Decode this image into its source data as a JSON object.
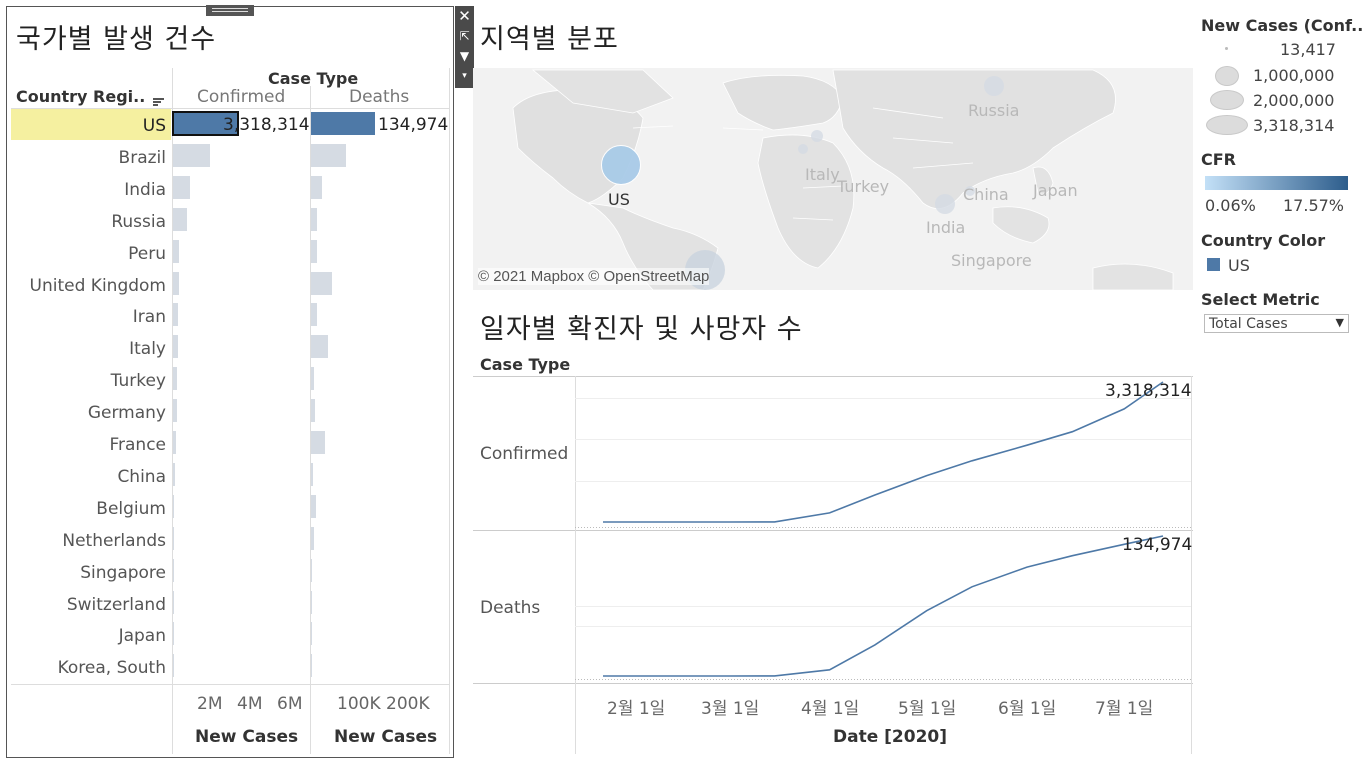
{
  "sheets": {
    "country_title": "국가별 발생 건수",
    "map_title": "지역별 분포",
    "daily_title": "일자별 확진자 및 사망자 수"
  },
  "bar_table": {
    "row_header": "Country Regi..",
    "case_type_header": "Case Type",
    "columns": [
      "Confirmed",
      "Deaths"
    ],
    "axis_title": "New Cases",
    "confirmed_ticks": [
      "2M",
      "4M",
      "6M"
    ],
    "deaths_ticks": [
      "100K",
      "200K"
    ],
    "us_confirmed_label": "3,318,314",
    "us_deaths_label": "134,974"
  },
  "map": {
    "attribution": "© 2021 Mapbox © OpenStreetMap",
    "labels": [
      "US",
      "Russia",
      "Italy",
      "Turkey",
      "China",
      "Japan",
      "India",
      "Singapore"
    ]
  },
  "line_panel": {
    "case_type_header": "Case Type",
    "row_confirmed": "Confirmed",
    "row_deaths": "Deaths",
    "x_title": "Date [2020]",
    "confirmed_end_label": "3,318,314",
    "deaths_end_label": "134,974"
  },
  "legend": {
    "size_title": "New Cases (Conf..",
    "size_values": [
      "13,417",
      "1,000,000",
      "2,000,000",
      "3,318,314"
    ],
    "cfr_title": "CFR",
    "cfr_min": "0.06%",
    "cfr_max": "17.57%",
    "country_color_title": "Country Color",
    "country_color_item": "US",
    "metric_title": "Select Metric",
    "metric_value": "Total Cases"
  },
  "colors": {
    "bar_primary": "#4e79a7",
    "bar_muted": "#d5dbe3",
    "highlight": "#f5f0a0",
    "line": "#4e79a7"
  },
  "chart_data": [
    {
      "type": "bar",
      "title": "국가별 발생 건수",
      "series_column": "Confirmed",
      "categories": [
        "US",
        "Brazil",
        "India",
        "Russia",
        "Peru",
        "United Kingdom",
        "Iran",
        "Italy",
        "Turkey",
        "Germany",
        "France",
        "China",
        "Belgium",
        "Netherlands",
        "Singapore",
        "Switzerland",
        "Japan",
        "Korea, South"
      ],
      "values": [
        3318314,
        1880000,
        880000,
        740000,
        330000,
        290000,
        260000,
        243000,
        213000,
        199000,
        172000,
        85000,
        62000,
        51000,
        46000,
        32000,
        21000,
        13417
      ],
      "xlabel": "New Cases",
      "xlim": [
        0,
        7000000
      ]
    },
    {
      "type": "bar",
      "title": "국가별 발생 건수",
      "series_column": "Deaths",
      "categories": [
        "US",
        "Brazil",
        "India",
        "Russia",
        "Peru",
        "United Kingdom",
        "Iran",
        "Italy",
        "Turkey",
        "Germany",
        "France",
        "China",
        "Belgium",
        "Netherlands",
        "Singapore",
        "Switzerland",
        "Japan",
        "Korea, South"
      ],
      "values": [
        134974,
        72800,
        22600,
        11600,
        11900,
        44700,
        12800,
        34900,
        5300,
        9100,
        30000,
        4600,
        9800,
        6100,
        26,
        1970,
        980,
        289
      ],
      "xlabel": "New Cases",
      "xlim": [
        0,
        260000
      ]
    },
    {
      "type": "line",
      "title": "일자별 확진자 및 사망자 수",
      "x": [
        "2020-01-22",
        "2020-02-01",
        "2020-03-01",
        "2020-03-15",
        "2020-04-01",
        "2020-04-15",
        "2020-05-01",
        "2020-05-15",
        "2020-06-01",
        "2020-06-15",
        "2020-07-01",
        "2020-07-13"
      ],
      "series": [
        {
          "name": "Confirmed",
          "values": [
            1,
            8,
            30,
            3000,
            215000,
            640000,
            1100000,
            1450000,
            1820000,
            2140000,
            2680000,
            3318314
          ]
        },
        {
          "name": "Deaths",
          "values": [
            0,
            0,
            1,
            60,
            6000,
            30000,
            63000,
            86000,
            105000,
            116000,
            127000,
            134974
          ]
        }
      ],
      "xlabel": "Date [2020]",
      "x_ticks": [
        "2월 1일",
        "3월 1일",
        "4월 1일",
        "5월 1일",
        "6월 1일",
        "7월 1일"
      ]
    }
  ]
}
